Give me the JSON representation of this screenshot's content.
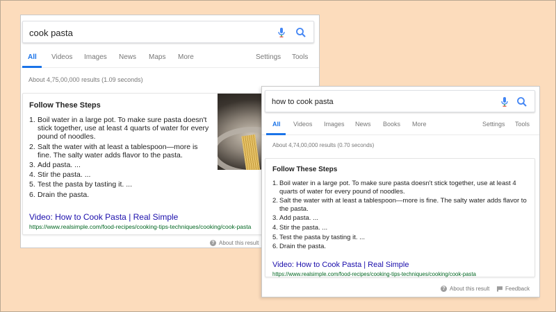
{
  "back": {
    "query": "cook pasta",
    "tabs": [
      "All",
      "Videos",
      "Images",
      "News",
      "Maps",
      "More"
    ],
    "tools": [
      "Settings",
      "Tools"
    ],
    "stats": "About 4,75,00,000 results (1.09 seconds)",
    "card_title": "Follow These Steps",
    "steps": [
      {
        "num": "1.",
        "text": "Boil water in a large pot. To make sure pasta doesn't stick together, use at least 4 quarts of water for every pound of noodles."
      },
      {
        "num": "2.",
        "text": "Salt the water with at least a tablespoon—more is fine. The salty water adds flavor to the pasta."
      },
      {
        "num": "3.",
        "text": "Add pasta. ..."
      },
      {
        "num": "4.",
        "text": "Stir the pasta. ..."
      },
      {
        "num": "5.",
        "text": "Test the pasta by tasting it. ..."
      },
      {
        "num": "6.",
        "text": "Drain the pasta."
      }
    ],
    "video_link": "Video: How to Cook Pasta | Real Simple",
    "url": "https://www.realsimple.com/food-recipes/cooking-tips-techniques/cooking/cook-pasta",
    "about": "About this result"
  },
  "front": {
    "query": "how to cook pasta",
    "tabs": [
      "All",
      "Videos",
      "Images",
      "News",
      "Books",
      "More"
    ],
    "tools": [
      "Settings",
      "Tools"
    ],
    "stats": "About 4,74,00,000 results (0.70 seconds)",
    "card_title": "Follow These Steps",
    "steps": [
      {
        "num": "1.",
        "text": "Boil water in a large pot. To make sure pasta doesn't stick together, use at least 4 quarts of water for every pound of noodles."
      },
      {
        "num": "2.",
        "text": "Salt the water with at least a tablespoon—more is fine. The salty water adds flavor to the pasta."
      },
      {
        "num": "3.",
        "text": "Add pasta. ..."
      },
      {
        "num": "4.",
        "text": "Stir the pasta. ..."
      },
      {
        "num": "5.",
        "text": "Test the pasta by tasting it. ..."
      },
      {
        "num": "6.",
        "text": "Drain the pasta."
      }
    ],
    "video_link": "Video: How to Cook Pasta | Real Simple",
    "url": "https://www.realsimple.com/food-recipes/cooking-tips-techniques/cooking/cook-pasta",
    "about": "About this result",
    "feedback": "Feedback"
  },
  "colors": {
    "background": "#fcdcbc",
    "accent": "#1a73e8",
    "link": "#1a0dab",
    "url_green": "#006621"
  },
  "icons": [
    "mic-icon",
    "search-icon",
    "question-icon",
    "flag-icon"
  ]
}
